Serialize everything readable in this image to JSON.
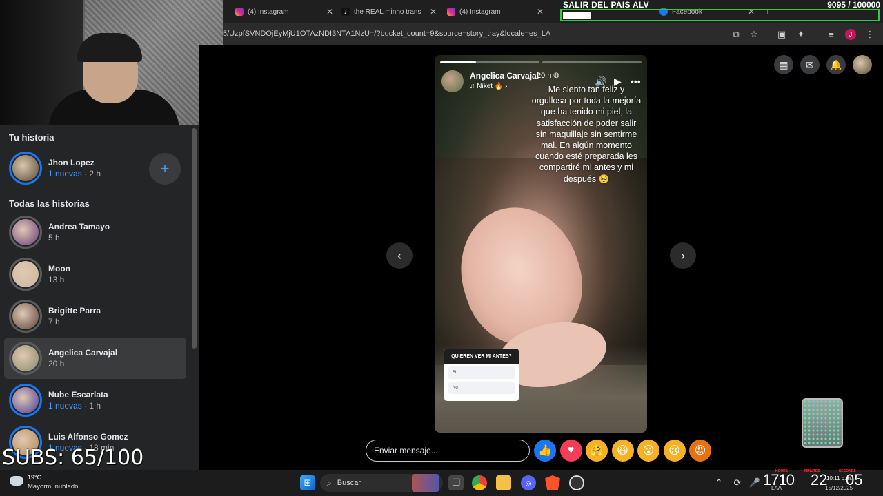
{
  "browser": {
    "tabs": [
      {
        "label": "(4) Instagram",
        "favicon": "instagram-icon",
        "color": "#d6249f"
      },
      {
        "label": "the REAL minho transit",
        "favicon": "tiktok-icon",
        "color": "#111111"
      },
      {
        "label": "(4) Instagram",
        "favicon": "instagram-icon",
        "color": "#d6249f"
      },
      {
        "label": "Facebook",
        "favicon": "facebook-icon",
        "color": "#1877f2"
      }
    ],
    "url": "5/UzpfSVNDOjEyMjU1OTAzNDI3NTA1NzU=/?bucket_count=9&source=story_tray&locale=es_LA"
  },
  "overlay": {
    "title": "SALIR DEL PAIS ALV",
    "counter": "9095 / 100000",
    "progress": 0.09,
    "subs": "SUBS: 65/100"
  },
  "sidebar": {
    "your_story_heading": "Tu historia",
    "your_story": {
      "name": "Jhon Lopez",
      "new": "1 nuevas",
      "time": " · 2 h"
    },
    "add_label": "+",
    "all_stories_heading": "Todas las historias",
    "stories": [
      {
        "name": "Andrea Tamayo",
        "new": "",
        "time": "5 h",
        "unread": false,
        "color": "#6a3d7a"
      },
      {
        "name": "Moon",
        "new": "",
        "time": "13 h",
        "unread": false,
        "color": "#c9b79c"
      },
      {
        "name": "Brigitte Parra",
        "new": "",
        "time": "7 h",
        "unread": false,
        "color": "#5a4238"
      },
      {
        "name": "Angelica Carvajal",
        "new": "",
        "time": "20 h",
        "unread": false,
        "color": "#8a8a6a"
      },
      {
        "name": "Nube Escarlata",
        "new": "1 nuevas",
        "time": " · 1 h",
        "unread": true,
        "color": "#4a3a9a"
      },
      {
        "name": "Luis Alfonso Gomez",
        "new": "1 nuevas",
        "time": " · 18 min",
        "unread": true,
        "color": "#b08850"
      }
    ]
  },
  "story": {
    "author": "Angelica Carvajal",
    "time": "20 h",
    "music": "Niket",
    "progress": 0.18,
    "segments": 2,
    "text": "Me siento tan feliz y orgullosa por toda la mejoría que ha tenido mi piel, la satisfacción de poder salir sin maquillaje sin sentirme mal. En algún momento cuando esté preparada les compartiré mi antes y mi después 🥺",
    "poll": {
      "question": "QUIEREN VER MI ANTES?",
      "options": [
        "Si",
        "No"
      ]
    }
  },
  "reply": {
    "placeholder": "Enviar mensaje..."
  },
  "reactions": [
    {
      "name": "like-reaction",
      "glyph": "👍",
      "color": "#1877f2"
    },
    {
      "name": "love-reaction",
      "glyph": "♥",
      "color": "#f33e58"
    },
    {
      "name": "care-reaction",
      "glyph": "🤗",
      "color": "#f7b125"
    },
    {
      "name": "haha-reaction",
      "glyph": "😆",
      "color": "#f7b125"
    },
    {
      "name": "wow-reaction",
      "glyph": "😮",
      "color": "#f7b125"
    },
    {
      "name": "sad-reaction",
      "glyph": "😢",
      "color": "#f7b125"
    },
    {
      "name": "angry-reaction",
      "glyph": "😡",
      "color": "#e9710f"
    }
  ],
  "taskbar": {
    "temp": "19°C",
    "weather": "Mayorm. nublado",
    "search": "Buscar",
    "clock_hours": "1710",
    "clock_minutes": "22",
    "clock_seconds": "05",
    "lang": "LAA",
    "sys_time": "10:11 p.m.",
    "sys_date": "15/12/2025",
    "timer_labels": [
      "HOURS",
      "MINUTES",
      "SECONDS"
    ]
  }
}
